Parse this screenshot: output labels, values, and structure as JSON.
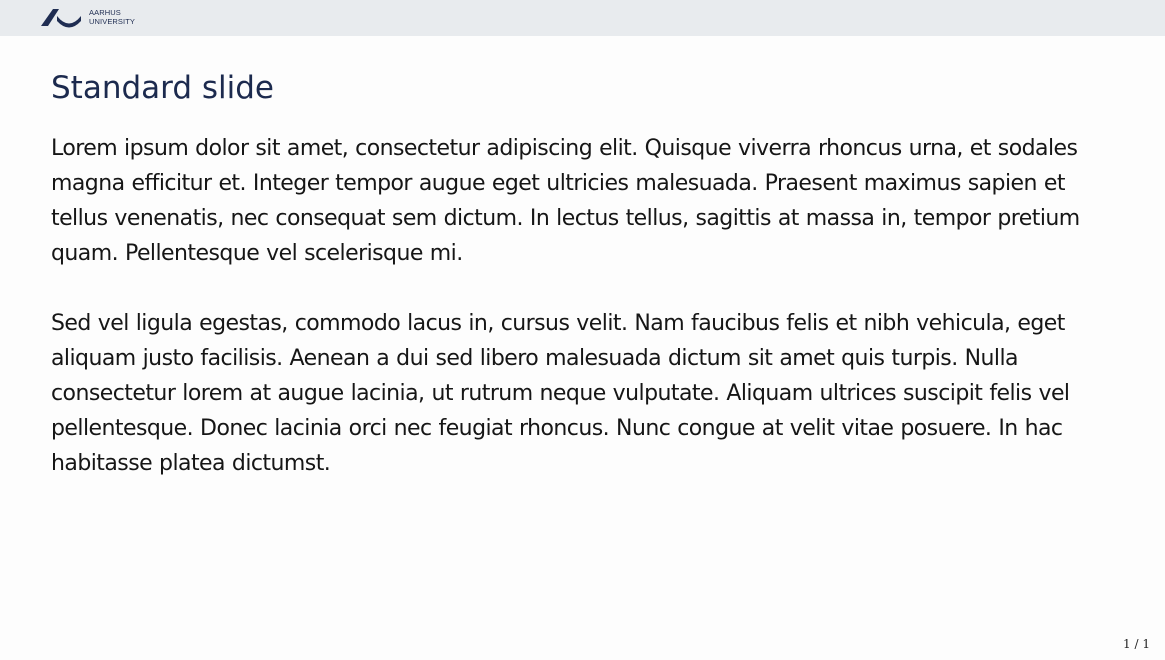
{
  "header": {
    "logo_icon": "aarhus-university-seal-icon",
    "logo_line1": "AARHUS",
    "logo_line2": "UNIVERSITY",
    "brand_color": "#1f2d52",
    "bar_color": "#e8ebee"
  },
  "slide": {
    "title": "Standard slide",
    "title_color": "#1c2a4e",
    "paragraphs": [
      "Lorem ipsum dolor sit amet, consectetur adipiscing elit. Quisque viverra rhoncus urna, et sodales magna efficitur et. Integer tempor augue eget ultricies malesuada. Praesent maximus sapien et tellus venenatis, nec consequat sem dictum. In lectus tellus, sagittis at massa in, tempor pretium quam. Pellentesque vel scelerisque mi.",
      "Sed vel ligula egestas, commodo lacus in, cursus velit. Nam faucibus felis et nibh vehicula, eget aliquam justo facilisis. Aenean a dui sed libero malesuada dictum sit amet quis turpis. Nulla consectetur lorem at augue lacinia, ut rutrum neque vulputate. Aliquam ultrices suscipit felis vel pellentesque. Donec lacinia orci nec feugiat rhoncus. Nunc congue at velit vitae posuere. In hac habitasse platea dictumst."
    ]
  },
  "footer": {
    "page_number": "1 / 1"
  }
}
